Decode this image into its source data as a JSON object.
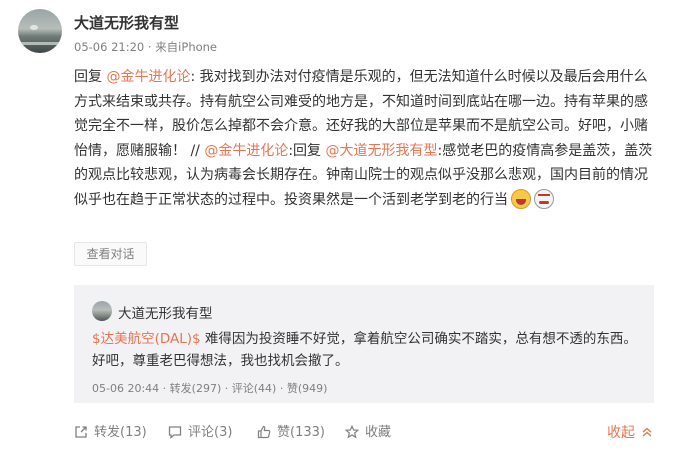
{
  "post": {
    "username": "大道无形我有型",
    "time": "05-06 21:20",
    "source": "来自iPhone",
    "content": {
      "prefix": "回复",
      "mention1": "@金牛进化论",
      "text1": ": 我对找到办法对付疫情是乐观的，但无法知道什么时候以及最后会用什么方式来结束或共存。持有航空公司难受的地方是，不知道时间到底站在哪一边。持有苹果的感觉完全不一样，股价怎么掉都不会介意。还好我的大部位是苹果而不是航空公司。好吧，小赌怡情，愿赌服输！ // ",
      "mention2": "@金牛进化论",
      "text2": ":回复",
      "mention3": "@大道无形我有型",
      "text3": ":感觉老巴的疫情高参是盖茨，盖茨的观点比较悲观，认为病毒会长期存在。钟南山院士的观点似乎没那么悲观，国内目前的情况似乎也在趋于正常状态的过程中。投资果然是一个活到老学到老的行当",
      "emoji1": "laugh-emoji",
      "emoji2": "smirk-emoji"
    },
    "view_conversation": "查看对话"
  },
  "repost": {
    "username": "大道无形我有型",
    "stock": "$达美航空(DAL)$",
    "text": " 难得因为投资睡不好觉，拿着航空公司确实不踏实，总有想不透的东西。好吧，尊重老巴得想法，我也找机会撤了。",
    "time": "05-06 20:44",
    "forward": "转发(297)",
    "comment": "评论(44)",
    "like": "赞(949)"
  },
  "footer": {
    "forward": "转发(13)",
    "comment": "评论(3)",
    "like": "赞(133)",
    "favorite": "收藏",
    "collapse": "收起"
  },
  "colors": {
    "link": "#eb7350",
    "meta": "#808080",
    "repost_bg": "#f2f2f5"
  }
}
